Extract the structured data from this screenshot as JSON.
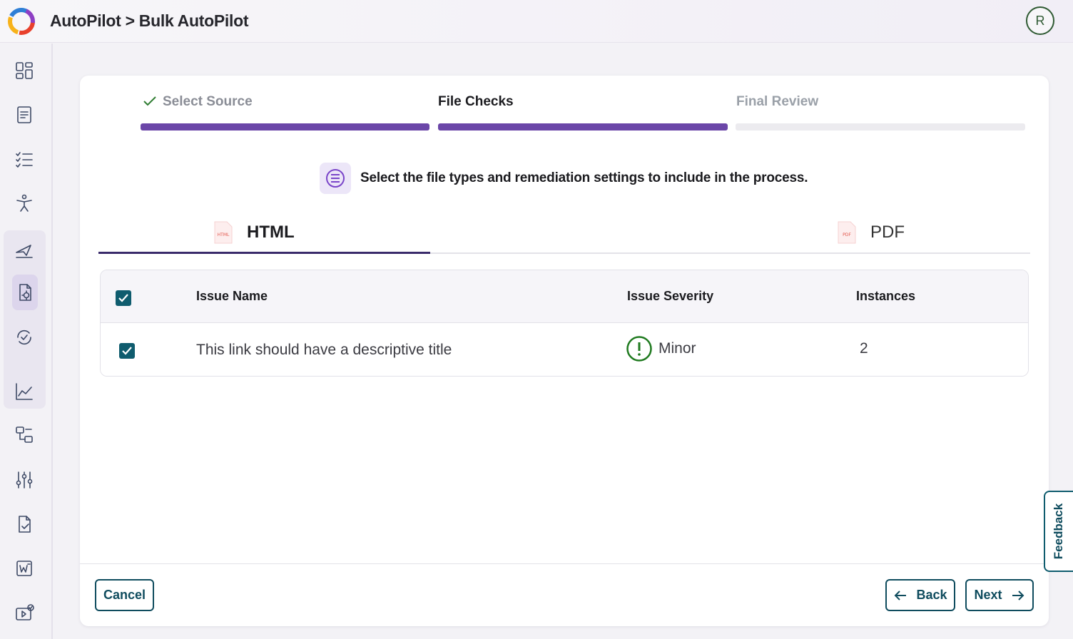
{
  "header": {
    "breadcrumb": "AutoPilot > Bulk AutoPilot",
    "avatar_initial": "R",
    "logo_icon": "brand-swirl-logo"
  },
  "sidebar": {
    "items": [
      {
        "icon": "dashboard-grid-icon"
      },
      {
        "icon": "document-icon"
      },
      {
        "icon": "checklist-icon"
      },
      {
        "icon": "accessibility-icon"
      },
      {
        "icon": "autopilot-plane-icon"
      },
      {
        "icon": "bulk-document-gear-icon",
        "active": true
      },
      {
        "icon": "refresh-check-icon"
      },
      {
        "icon": "line-chart-icon"
      },
      {
        "icon": "workflow-icon"
      },
      {
        "icon": "sliders-icon"
      },
      {
        "icon": "document-edit-icon"
      },
      {
        "icon": "word-document-icon"
      },
      {
        "icon": "video-check-icon"
      }
    ]
  },
  "steps": [
    {
      "label": "Select Source",
      "state": "done"
    },
    {
      "label": "File Checks",
      "state": "current"
    },
    {
      "label": "Final Review",
      "state": "future"
    }
  ],
  "instruction": "Select the file types and remediation settings to include in the process.",
  "tabs": [
    {
      "label": "HTML",
      "icon_text": "HTML",
      "active": true
    },
    {
      "label": "PDF",
      "icon_text": "PDF",
      "active": false
    }
  ],
  "table": {
    "headers": {
      "name": "Issue Name",
      "severity": "Issue Severity",
      "instances": "Instances"
    },
    "rows": [
      {
        "name": "This link should have a descriptive title",
        "severity": "Minor",
        "instances": "2",
        "checked": true
      }
    ]
  },
  "buttons": {
    "cancel": "Cancel",
    "back": "Back",
    "next": "Next"
  },
  "feedback": "Feedback",
  "colors": {
    "accent_purple": "#6b46a8",
    "teal": "#0f5c6e",
    "minor_green": "#1f7a1f"
  }
}
